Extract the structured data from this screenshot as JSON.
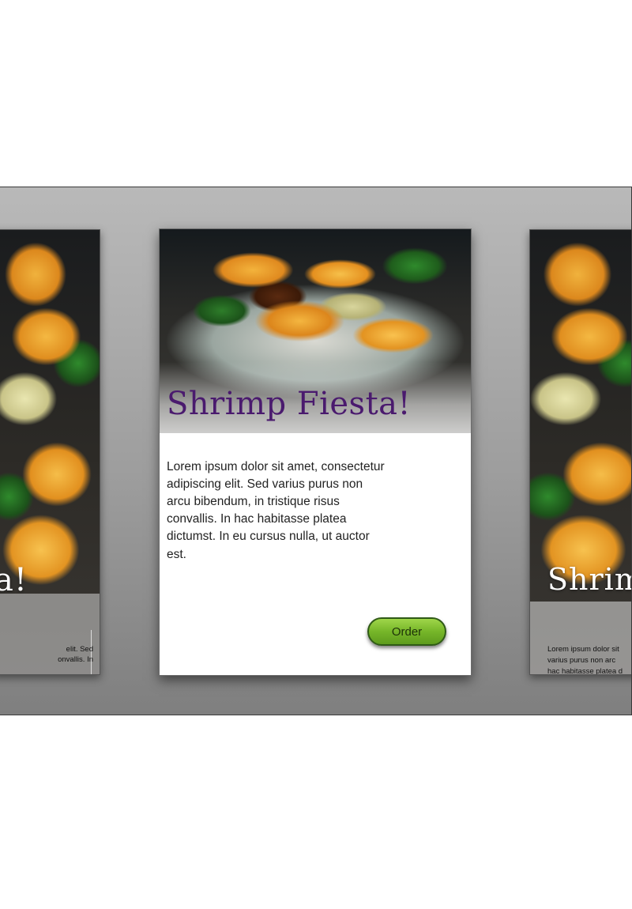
{
  "cards": {
    "left": {
      "title_fragment": "a!",
      "text_lines": [
        "elit. Sed",
        "onvallis. In"
      ]
    },
    "center": {
      "title": "Shrimp Fiesta!",
      "body": "Lorem ipsum dolor sit amet, consectetur adipiscing elit. Sed varius purus non arcu bibendum, in tristique risus convallis. In hac habitasse platea dictumst. In eu cursus nulla, ut auctor est.",
      "button_label": "Order"
    },
    "right": {
      "title_fragment": "Shrim",
      "text_lines": [
        "Lorem ipsum dolor sit",
        "varius purus non arc",
        "hac habitasse platea d"
      ]
    }
  },
  "colors": {
    "title": "#4a1a6e",
    "button": "#76b629",
    "stage": "#a3a3a3"
  },
  "icons": []
}
